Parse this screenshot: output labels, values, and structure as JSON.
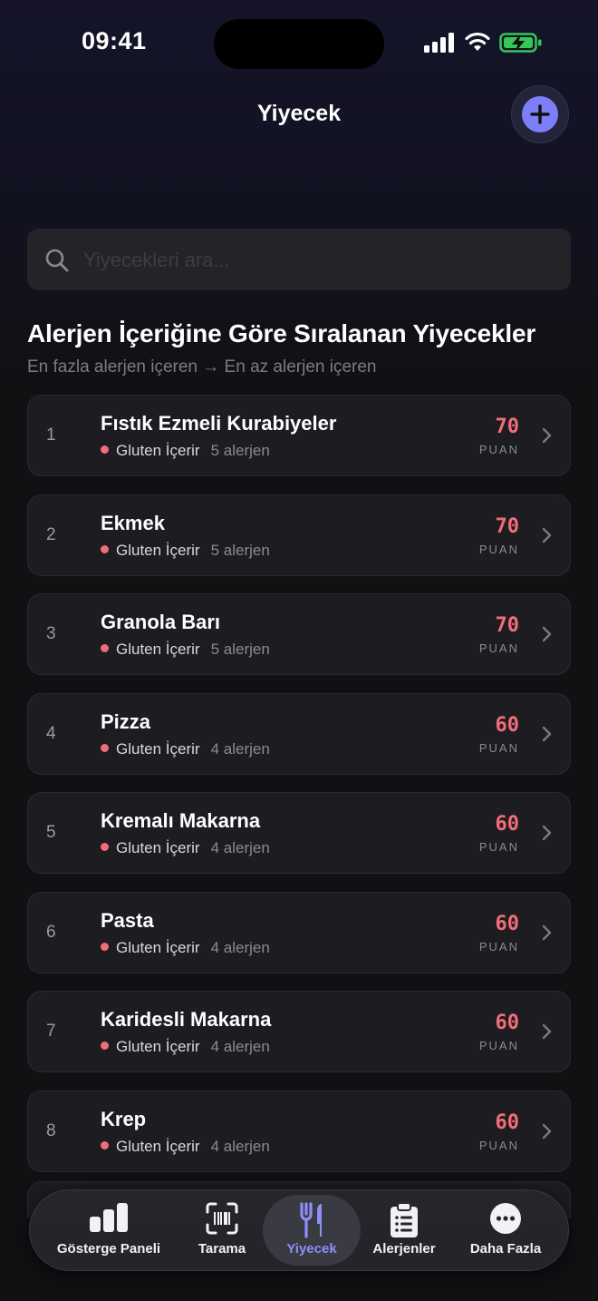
{
  "status": {
    "time": "09:41"
  },
  "header": {
    "title": "Yiyecek",
    "add_icon": "plus-icon"
  },
  "search": {
    "placeholder": "Yiyecekleri ara..."
  },
  "section": {
    "title": "Alerjen İçeriğine Göre Sıralanan Yiyecekler",
    "subtitle": "En fazla alerjen içeren → En az alerjen içeren"
  },
  "score_label": "PUAN",
  "foods": [
    {
      "rank": "1",
      "name": "Fıstık Ezmeli Kurabiyeler",
      "tag": "Gluten İçerir",
      "allergens": "5 alerjen",
      "score": "70"
    },
    {
      "rank": "2",
      "name": "Ekmek",
      "tag": "Gluten İçerir",
      "allergens": "5 alerjen",
      "score": "70"
    },
    {
      "rank": "3",
      "name": "Granola Barı",
      "tag": "Gluten İçerir",
      "allergens": "5 alerjen",
      "score": "70"
    },
    {
      "rank": "4",
      "name": "Pizza",
      "tag": "Gluten İçerir",
      "allergens": "4 alerjen",
      "score": "60"
    },
    {
      "rank": "5",
      "name": "Kremalı Makarna",
      "tag": "Gluten İçerir",
      "allergens": "4 alerjen",
      "score": "60"
    },
    {
      "rank": "6",
      "name": "Pasta",
      "tag": "Gluten İçerir",
      "allergens": "4 alerjen",
      "score": "60"
    },
    {
      "rank": "7",
      "name": "Karidesli Makarna",
      "tag": "Gluten İçerir",
      "allergens": "4 alerjen",
      "score": "60"
    },
    {
      "rank": "8",
      "name": "Krep",
      "tag": "Gluten İçerir",
      "allergens": "4 alerjen",
      "score": "60"
    }
  ],
  "tabs": [
    {
      "label": "Gösterge Paneli",
      "icon": "bar-chart-icon",
      "active": false
    },
    {
      "label": "Tarama",
      "icon": "barcode-scan-icon",
      "active": false
    },
    {
      "label": "Yiyecek",
      "icon": "fork-knife-icon",
      "active": true
    },
    {
      "label": "Alerjenler",
      "icon": "clipboard-list-icon",
      "active": false
    },
    {
      "label": "Daha Fazla",
      "icon": "more-icon",
      "active": false
    }
  ],
  "colors": {
    "accent": "#7d7ff8",
    "score": "#f26d7a",
    "tag_dot": "#f26d7a",
    "card": "#1c1c21"
  }
}
